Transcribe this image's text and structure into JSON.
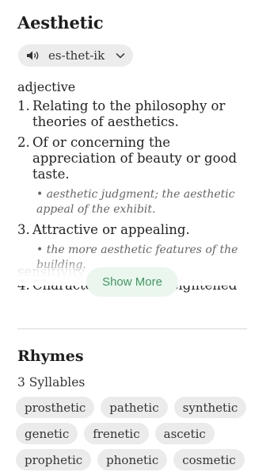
{
  "word": "Aesthetic",
  "pronunciation": {
    "text": "es-thet-ik",
    "icon": "speaker-icon"
  },
  "part_of_speech": "adjective",
  "definitions": [
    {
      "number": "1.",
      "text": "Relating to the philosophy or theories of aesthetics."
    },
    {
      "number": "2.",
      "text": "Of or concerning the appreciation of beauty or good taste.",
      "example": "• aesthetic judgment; the aesthetic appeal of the exhibit."
    },
    {
      "number": "3.",
      "text": "Attractive or appealing.",
      "example": "• the more aesthetic features of the building."
    },
    {
      "number": "4.",
      "text": "Characterized by a heightened"
    }
  ],
  "truncated_text": "sensitivity",
  "show_more_label": "Show More",
  "rhymes": {
    "title": "Rhymes",
    "syllables_label": "3 Syllables",
    "words": [
      "prosthetic",
      "pathetic",
      "synthetic",
      "genetic",
      "frenetic",
      "ascetic",
      "prophetic",
      "phonetic",
      "cosmetic"
    ]
  }
}
